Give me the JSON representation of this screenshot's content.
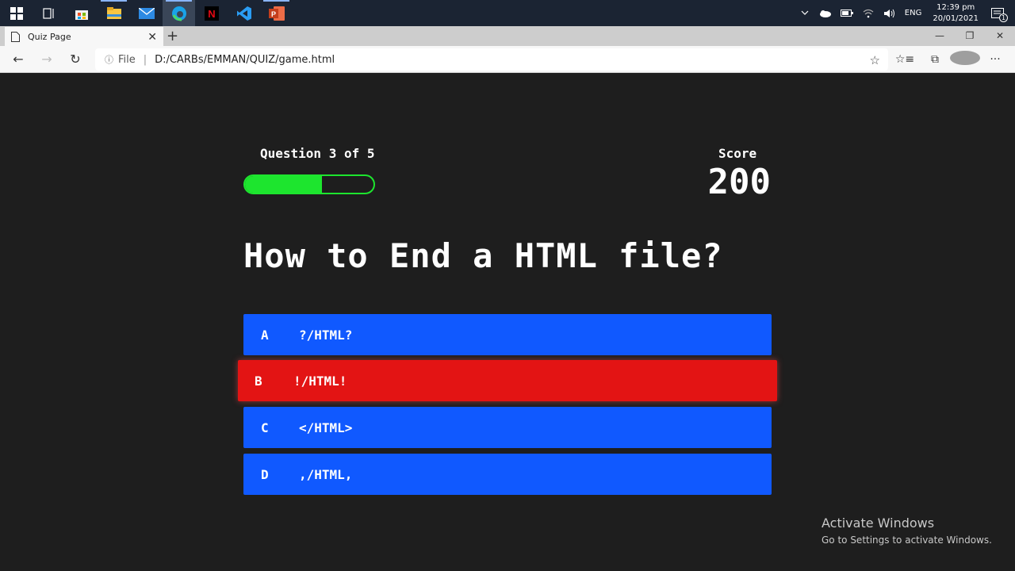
{
  "taskbar": {
    "apps": [
      "start-icon",
      "task-view-icon",
      "store-icon",
      "file-explorer-icon",
      "mail-icon",
      "edge-icon",
      "netflix-icon",
      "vscode-icon",
      "powerpoint-icon"
    ],
    "language": "ENG",
    "time": "12:39 pm",
    "date": "20/01/2021",
    "notification_count": "1"
  },
  "browser": {
    "tab_title": "Quiz Page",
    "url_scheme": "File",
    "url": "D:/CARBs/EMMAN/QUIZ/game.html"
  },
  "quiz": {
    "progress_text": "Question 3 of 5",
    "progress_fraction": 0.6,
    "score_label": "Score",
    "score": "200",
    "question": "How to End a HTML file?",
    "choices": [
      {
        "prefix": "A",
        "text": "?/HTML?",
        "state": "normal"
      },
      {
        "prefix": "B",
        "text": "!/HTML!",
        "state": "incorrect"
      },
      {
        "prefix": "C",
        "text": "</HTML>",
        "state": "normal"
      },
      {
        "prefix": "D",
        "text": ",/HTML,",
        "state": "normal"
      }
    ]
  },
  "watermark": {
    "title": "Activate Windows",
    "subtitle": "Go to Settings to activate Windows."
  },
  "colors": {
    "choice_default": "#1059ff",
    "choice_incorrect": "#e31414",
    "progress": "#1de52e",
    "background": "#1e1e1e"
  }
}
